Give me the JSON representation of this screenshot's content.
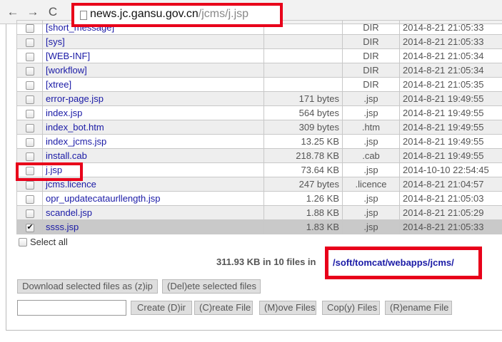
{
  "browser": {
    "url_host": "news.jc.gansu.gov.cn",
    "url_path": "/jcms/j.jsp",
    "back_icon": "←",
    "forward_icon": "→",
    "reload_icon": "C"
  },
  "files": [
    {
      "name": "[short_message]",
      "size": "",
      "type": "DIR",
      "date": "2014-8-21 21:05:33",
      "checked": false
    },
    {
      "name": "[sys]",
      "size": "",
      "type": "DIR",
      "date": "2014-8-21 21:05:33",
      "checked": false
    },
    {
      "name": "[WEB-INF]",
      "size": "",
      "type": "DIR",
      "date": "2014-8-21 21:05:34",
      "checked": false
    },
    {
      "name": "[workflow]",
      "size": "",
      "type": "DIR",
      "date": "2014-8-21 21:05:34",
      "checked": false
    },
    {
      "name": "[xtree]",
      "size": "",
      "type": "DIR",
      "date": "2014-8-21 21:05:35",
      "checked": false
    },
    {
      "name": "error-page.jsp",
      "size": "171 bytes",
      "type": ".jsp",
      "date": "2014-8-21 19:49:55",
      "checked": false
    },
    {
      "name": "index.jsp",
      "size": "564 bytes",
      "type": ".jsp",
      "date": "2014-8-21 19:49:55",
      "checked": false
    },
    {
      "name": "index_bot.htm",
      "size": "309 bytes",
      "type": ".htm",
      "date": "2014-8-21 19:49:55",
      "checked": false
    },
    {
      "name": "index_jcms.jsp",
      "size": "13.25 KB",
      "type": ".jsp",
      "date": "2014-8-21 19:49:55",
      "checked": false
    },
    {
      "name": "install.cab",
      "size": "218.78 KB",
      "type": ".cab",
      "date": "2014-8-21 19:49:55",
      "checked": false
    },
    {
      "name": "j.jsp",
      "size": "73.64 KB",
      "type": ".jsp",
      "date": "2014-10-10 22:54:45",
      "checked": false
    },
    {
      "name": "jcms.licence",
      "size": "247 bytes",
      "type": ".licence",
      "date": "2014-8-21 21:04:57",
      "checked": false
    },
    {
      "name": "opr_updatecataurllength.jsp",
      "size": "1.26 KB",
      "type": ".jsp",
      "date": "2014-8-21 21:05:03",
      "checked": false
    },
    {
      "name": "scandel.jsp",
      "size": "1.88 KB",
      "type": ".jsp",
      "date": "2014-8-21 21:05:29",
      "checked": false
    },
    {
      "name": "ssss.jsp",
      "size": "1.83 KB",
      "type": ".jsp",
      "date": "2014-8-21 21:05:33",
      "checked": true
    }
  ],
  "select_all_label": "Select all",
  "summary_text": "311.93 KB in 10 files in",
  "current_path": "/soft/tomcat/webapps/jcms/",
  "buttons": {
    "download": "Download selected files as (z)ip",
    "delete": "(Del)ete selected files",
    "mkdir": "Create (D)ir",
    "create_file": "(C)reate File",
    "move": "(M)ove Files",
    "copy": "Cop(y) Files",
    "rename": "(R)ename File"
  },
  "name_input": {
    "value": "",
    "placeholder": ""
  },
  "colors": {
    "highlight": "#e8001a",
    "link": "#1a1aa6",
    "selected_row": "#c9c9c9"
  }
}
